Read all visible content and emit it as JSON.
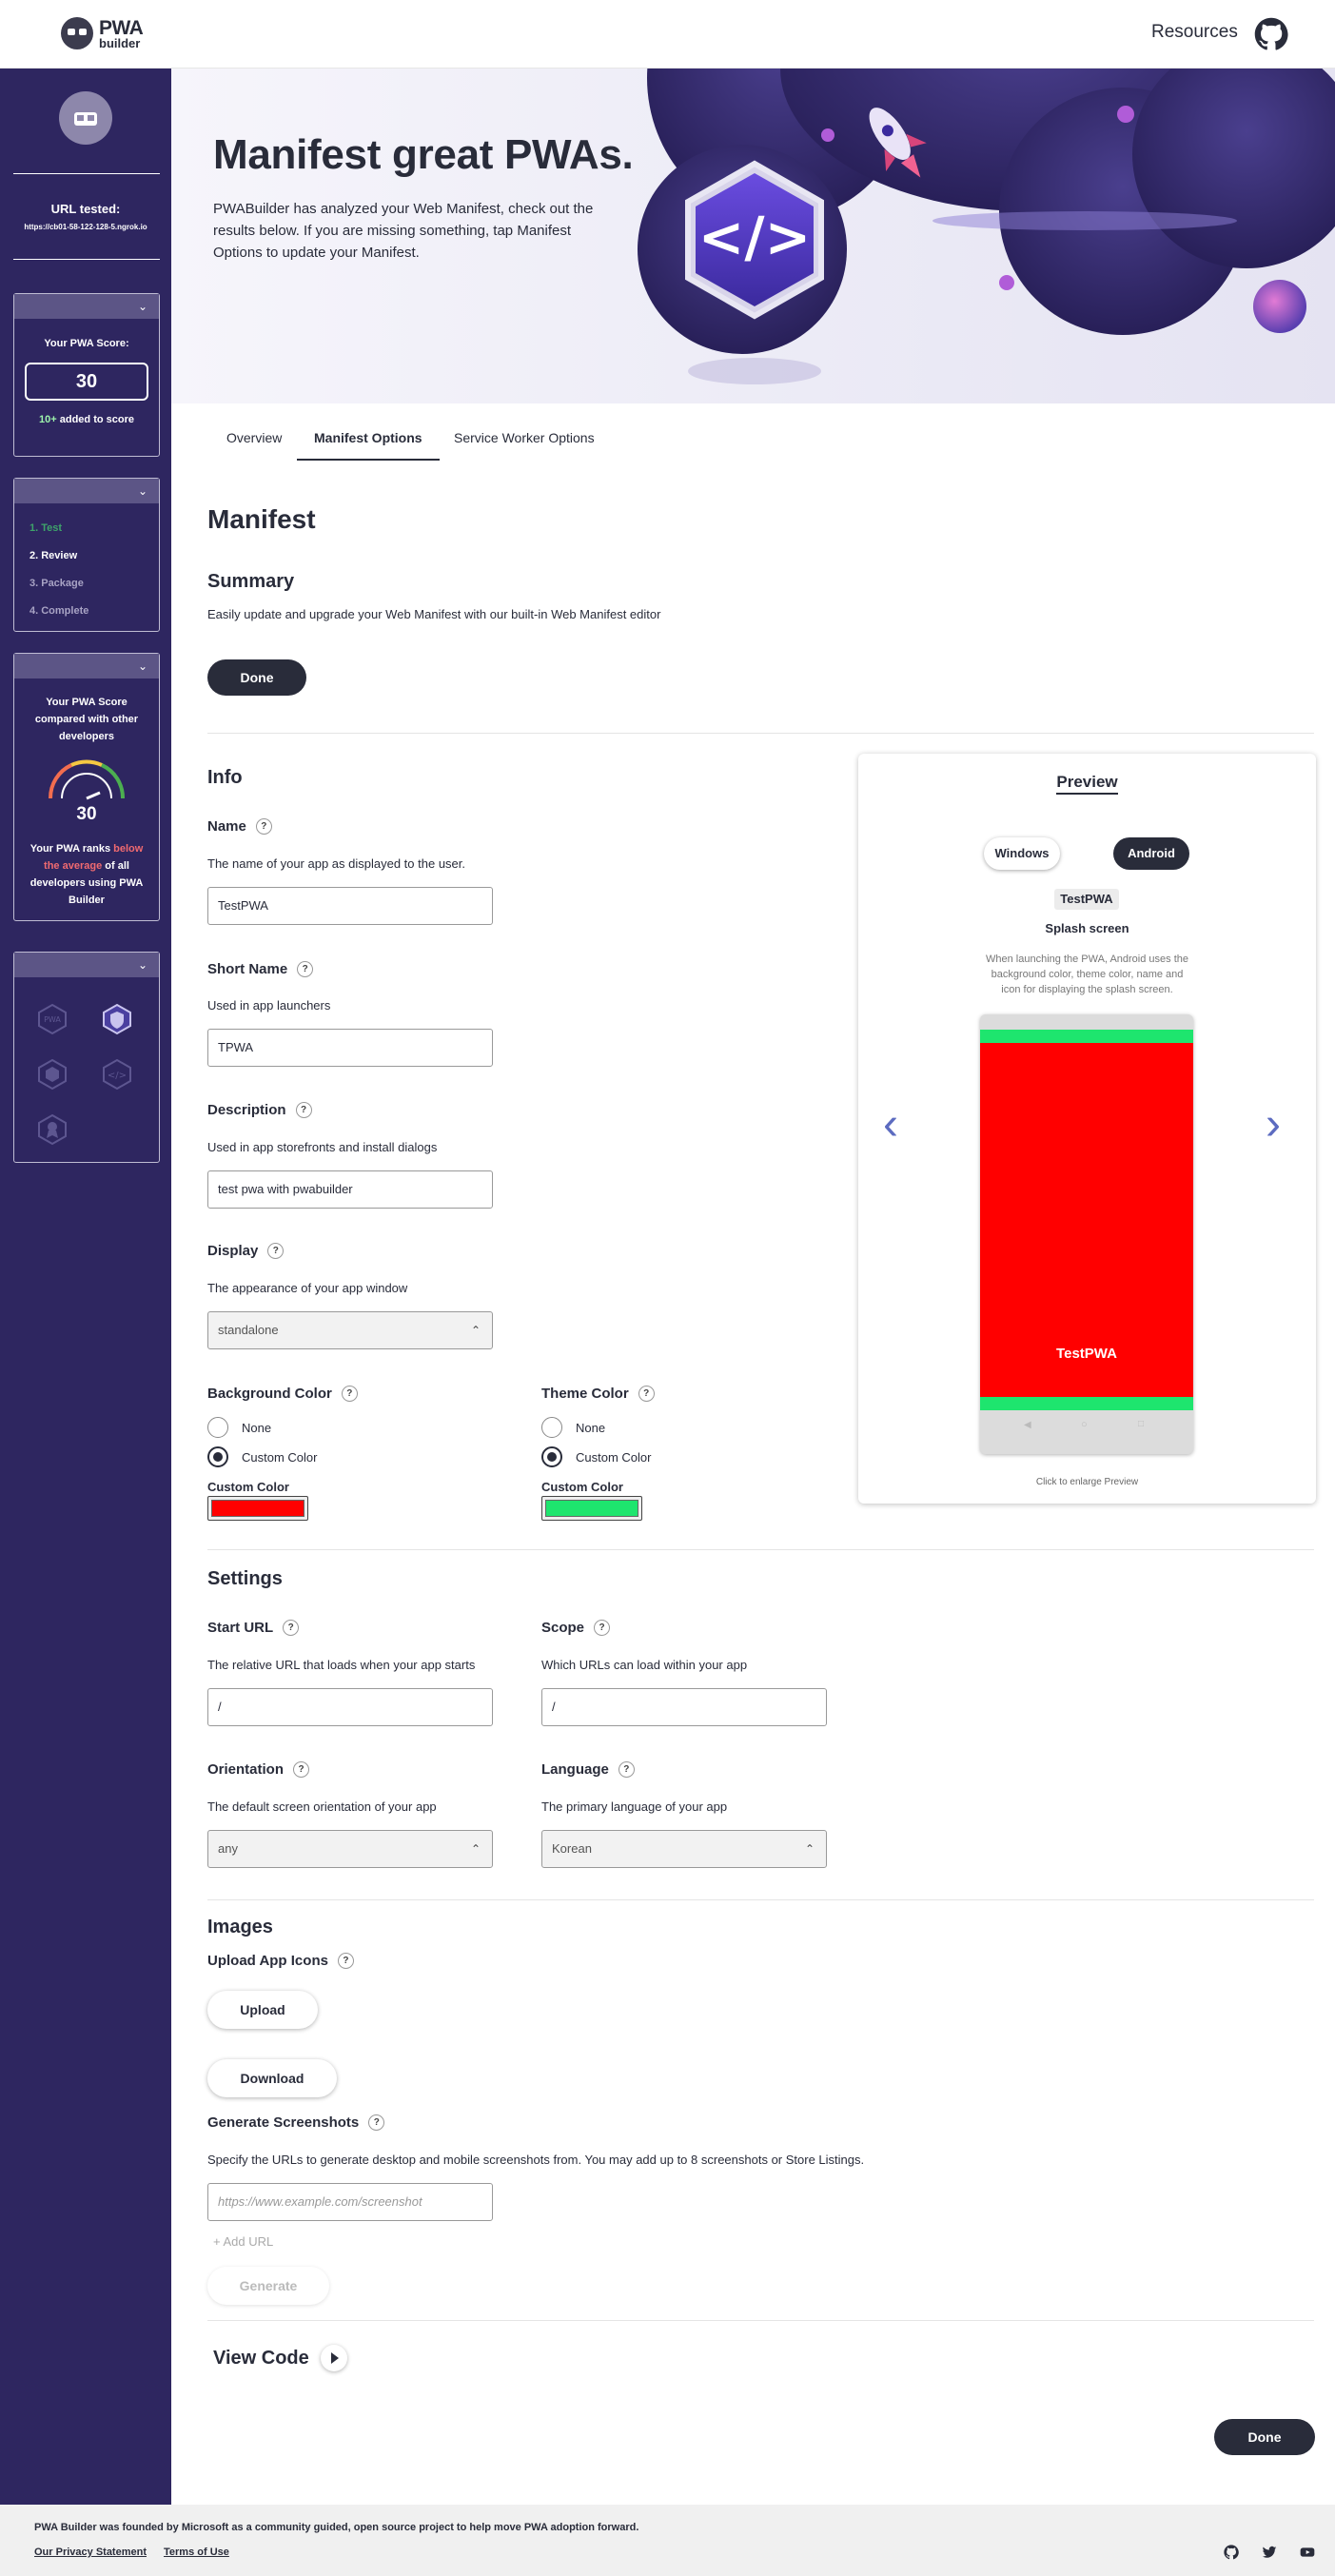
{
  "header": {
    "logo_line1": "PWA",
    "logo_line2": "builder",
    "resources": "Resources",
    "github_icon": "github-icon"
  },
  "sidebar": {
    "url_label": "URL tested:",
    "url_value": "https://cb01-58-122-128-5.ngrok.io",
    "score_title": "Your PWA Score:",
    "score_value": "30",
    "score_added_num": "10+",
    "score_added_text": " added to score",
    "steps": [
      "1. Test",
      "2. Review",
      "3. Package",
      "4. Complete"
    ],
    "compare_title": "Your PWA Score compared with other developers",
    "compare_score": "30",
    "rank_pre": "Your PWA ranks ",
    "rank_emph": "below the average",
    "rank_post": " of all developers using PWA Builder",
    "badge_icons": [
      "pwa-badge-icon",
      "security-badge-icon",
      "hex-badge-icon",
      "code-badge-icon",
      "award-badge-icon"
    ]
  },
  "hero": {
    "title": "Manifest great PWAs.",
    "description": "PWABuilder has analyzed your Web Manifest, check out the results below. If you are missing something, tap Manifest Options to update your Manifest."
  },
  "tabs": [
    "Overview",
    "Manifest Options",
    "Service Worker Options"
  ],
  "manifest": {
    "title": "Manifest",
    "summary_title": "Summary",
    "summary_desc": "Easily update and upgrade your Web Manifest with our built-in Web Manifest editor",
    "done": "Done"
  },
  "info": {
    "title": "Info",
    "name_label": "Name",
    "name_desc": "The name of your app as displayed to the user.",
    "name_value": "TestPWA",
    "short_label": "Short Name",
    "short_desc": "Used in app launchers",
    "short_value": "TPWA",
    "desc_label": "Description",
    "desc_desc": "Used in app storefronts and install dialogs",
    "desc_value": "test pwa with pwabuilder",
    "display_label": "Display",
    "display_desc": "The appearance of your app window",
    "display_value": "standalone",
    "bg_label": "Background Color",
    "theme_label": "Theme Color",
    "none": "None",
    "custom": "Custom Color",
    "custom_label": "Custom Color",
    "bg_color": "#ff0000",
    "theme_color": "#1ee56e"
  },
  "preview": {
    "title": "Preview",
    "windows": "Windows",
    "android": "Android",
    "app_name": "TestPWA",
    "splash_title": "Splash screen",
    "splash_desc": "When launching the PWA, Android uses the background color, theme color, name and icon for displaying the splash screen.",
    "click_hint": "Click to enlarge Preview",
    "prev_icon": "chevron-left-icon",
    "next_icon": "chevron-right-icon"
  },
  "settings": {
    "title": "Settings",
    "start_label": "Start URL",
    "start_desc": "The relative URL that loads when your app starts",
    "start_value": "/",
    "scope_label": "Scope",
    "scope_desc": "Which URLs can load within your app",
    "scope_value": "/",
    "orient_label": "Orientation",
    "orient_desc": "The default screen orientation of your app",
    "orient_value": "any",
    "lang_label": "Language",
    "lang_desc": "The primary language of your app",
    "lang_value": "Korean"
  },
  "images": {
    "title": "Images",
    "upload_label": "Upload App Icons",
    "upload": "Upload",
    "download": "Download",
    "screens_label": "Generate Screenshots",
    "screens_desc": "Specify the URLs to generate desktop and mobile screenshots from. You may add up to 8 screenshots or Store Listings.",
    "screens_placeholder": "https://www.example.com/screenshot",
    "add_url": "+ Add URL",
    "generate": "Generate"
  },
  "view_code": "View Code",
  "done_bottom": "Done",
  "footer": {
    "text": "PWA Builder was founded by Microsoft as a community guided, open source project to help move PWA adoption forward.",
    "privacy": "Our Privacy Statement",
    "terms": "Terms of Use",
    "icons": [
      "github-icon",
      "twitter-icon",
      "youtube-icon"
    ]
  }
}
